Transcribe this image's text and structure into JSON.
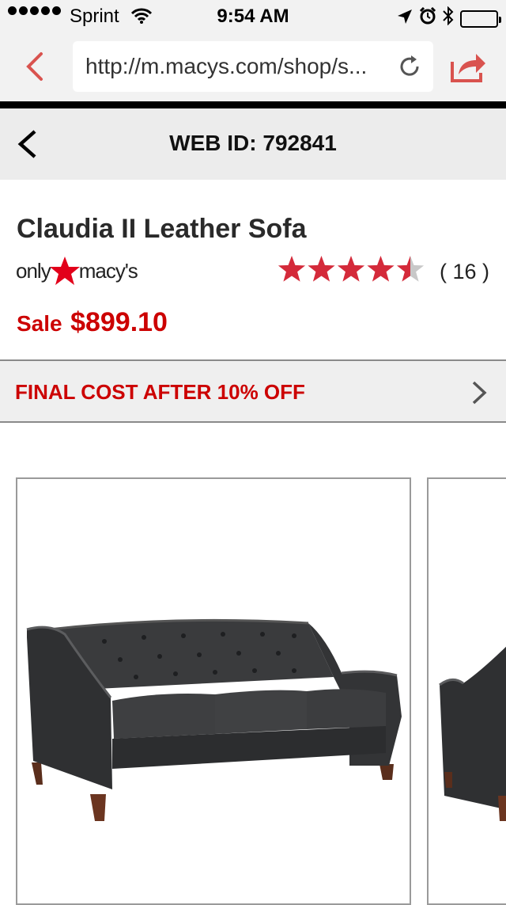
{
  "status_bar": {
    "carrier": "Sprint",
    "time": "9:54 AM"
  },
  "browser": {
    "url": "http://m.macys.com/shop/s..."
  },
  "header": {
    "web_id": "WEB ID: 792841"
  },
  "product": {
    "title": "Claudia II Leather Sofa",
    "brand_logo_text": "only macy's",
    "rating": 4.5,
    "rating_max": 5,
    "review_count": "( 16 )",
    "sale_label": "Sale",
    "sale_price": "$899.10"
  },
  "promo": {
    "label": "FINAL COST AFTER 10% OFF"
  },
  "colors": {
    "accent_red": "#cc0000",
    "star_red": "#d42a3a",
    "browser_icon_red": "#d9534f"
  }
}
